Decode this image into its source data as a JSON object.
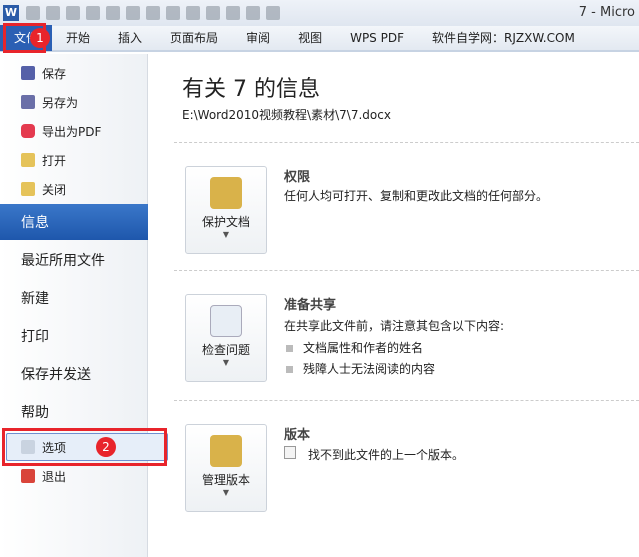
{
  "window": {
    "title": "7 - Micro"
  },
  "tabs": [
    "文件",
    "开始",
    "插入",
    "页面布局",
    "审阅",
    "视图",
    "WPS PDF",
    "软件自学网：RJZXW.COM"
  ],
  "badges": {
    "one": "1",
    "two": "2"
  },
  "sidebar": {
    "small": [
      "保存",
      "另存为",
      "导出为PDF",
      "打开",
      "关闭"
    ],
    "big": [
      "信息",
      "最近所用文件",
      "新建",
      "打印",
      "保存并发送",
      "帮助"
    ],
    "options": "选项",
    "exit": "退出"
  },
  "main": {
    "title": "有关 7 的信息",
    "path": "E:\\Word2010视频教程\\素材\\7\\7.docx",
    "sections": [
      {
        "button": "保护文档",
        "title": "权限",
        "desc": "任何人均可打开、复制和更改此文档的任何部分。"
      },
      {
        "button": "检查问题",
        "title": "准备共享",
        "desc": "在共享此文件前，请注意其包含以下内容:",
        "bullets": [
          "文档属性和作者的姓名",
          "残障人士无法阅读的内容"
        ]
      },
      {
        "button": "管理版本",
        "title": "版本",
        "desc": "找不到此文件的上一个版本。"
      }
    ]
  },
  "colors": {
    "accent": "#2b5fb4",
    "marker": "#e8242b"
  }
}
